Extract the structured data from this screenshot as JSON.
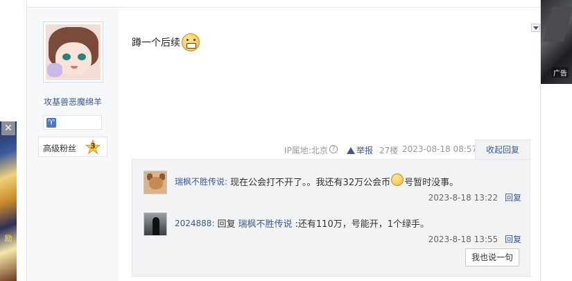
{
  "author": {
    "username": "攻基兽恶魔绵羊",
    "zodiac_symbol": "♈",
    "level_title": "高级粉丝",
    "level_number": "3"
  },
  "post": {
    "content": "蹲一个后续",
    "emoji": "grin-emoji"
  },
  "meta": {
    "ip_location": "IP属地:北京",
    "report_label": "举报",
    "floor": "27楼",
    "timestamp": "2023-08-18 08:57",
    "collapse_label": "收起回复"
  },
  "replies": [
    {
      "user": "瑞枫不胜传说:",
      "text_before_emoji": "现在公会打不开了。。我还有32万公会币",
      "text_after_emoji": "号暂时没事。",
      "time": "2023-8-18 13:22",
      "reply_label": "回复"
    },
    {
      "user": "2024888:",
      "prefix": "回复",
      "mention": "瑞枫不胜传说",
      "text": ":还有110万，号能开，1个绿手。",
      "time": "2023-8-18 13:55",
      "reply_label": "回复"
    }
  ],
  "say_button_label": "我也说一句",
  "side_ad": {
    "close_symbol": "✕",
    "text": "励"
  },
  "right_ad": {
    "label": "广告"
  },
  "colors": {
    "link": "#3d5a91",
    "author_bg": "#f7f8fa",
    "reply_bg": "#f2f3f5"
  }
}
